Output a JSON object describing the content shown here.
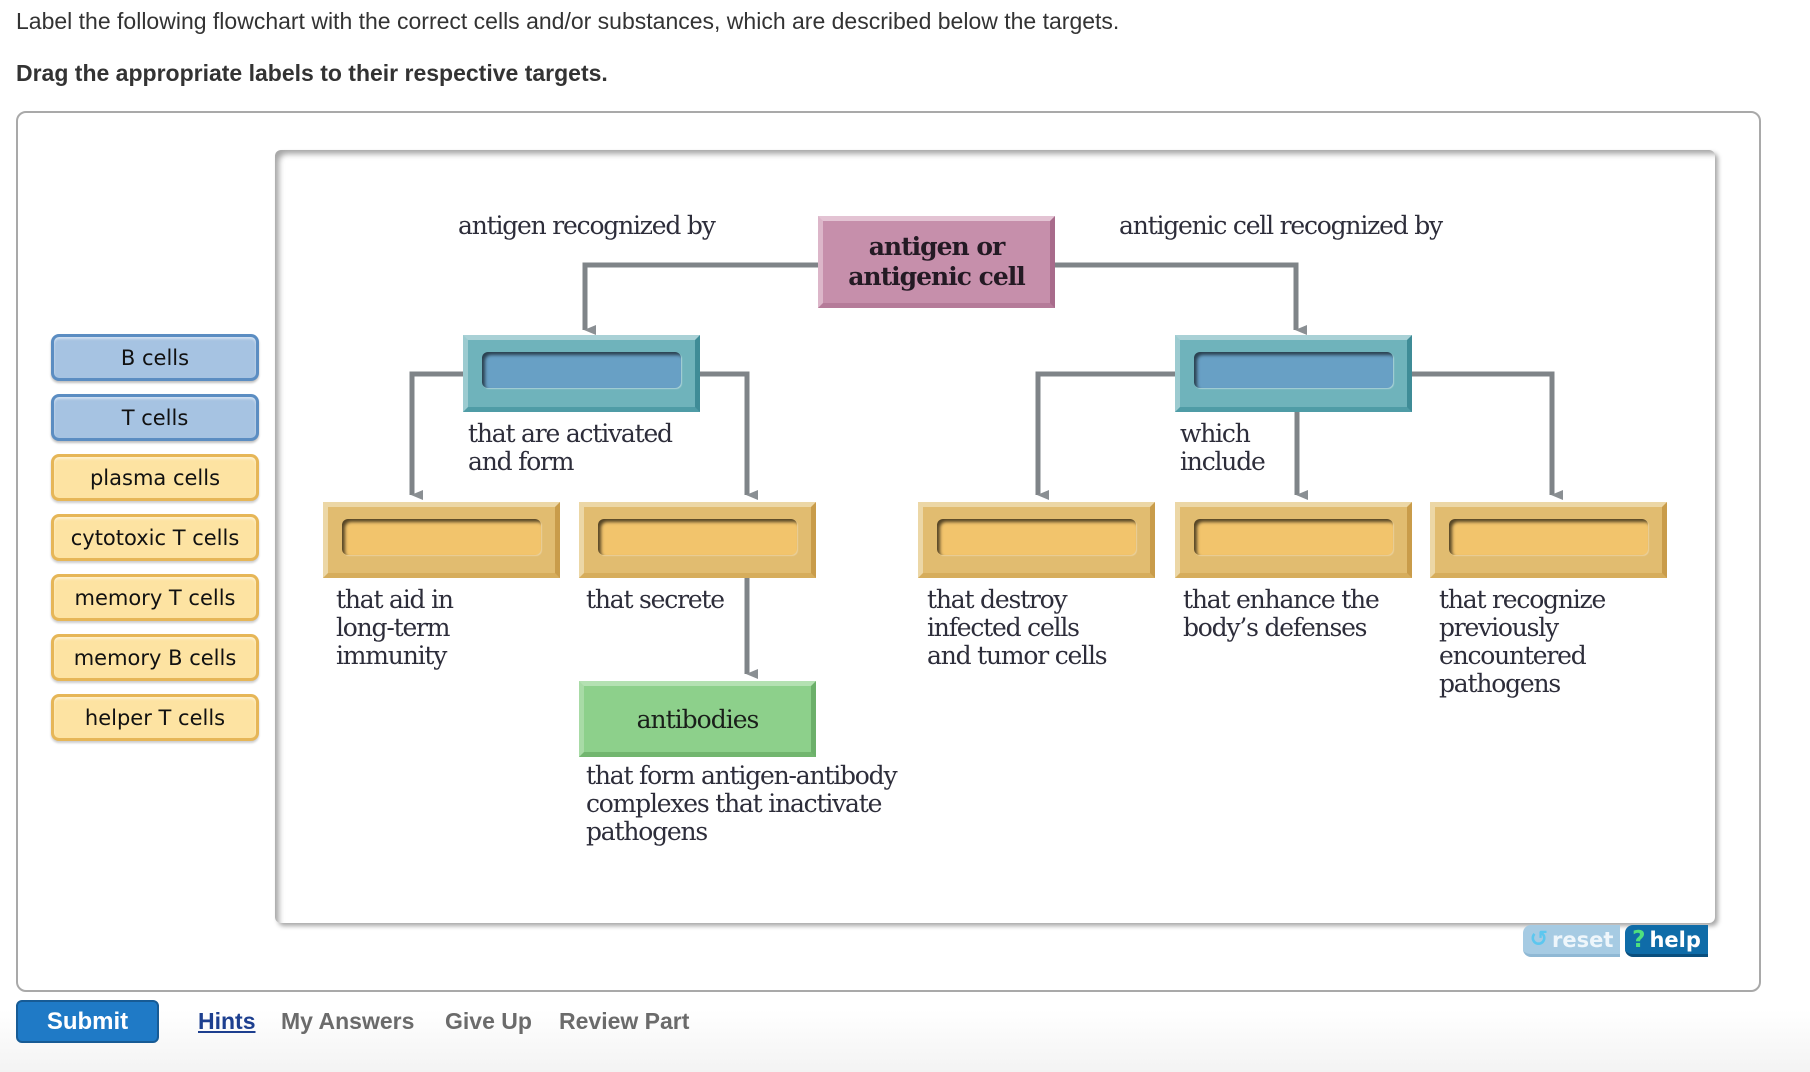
{
  "instructions": {
    "text": "Label the following flowchart with the correct cells and/or substances, which are described below the targets.",
    "bold": "Drag the appropriate labels to their respective targets."
  },
  "labels": [
    {
      "text": "B cells",
      "color": "blue"
    },
    {
      "text": "T cells",
      "color": "blue"
    },
    {
      "text": "plasma cells",
      "color": "yellow"
    },
    {
      "text": "cytotoxic T cells",
      "color": "yellow"
    },
    {
      "text": "memory T cells",
      "color": "yellow"
    },
    {
      "text": "memory B cells",
      "color": "yellow"
    },
    {
      "text": "helper T cells",
      "color": "yellow"
    }
  ],
  "diagram": {
    "root": {
      "line1": "antigen or",
      "line2": "antigenic cell"
    },
    "left_branch_caption": "antigen recognized by",
    "right_branch_caption": "antigenic cell recognized by",
    "left_target_caption": [
      "that are activated",
      "and form"
    ],
    "right_target_caption": [
      "which",
      "include"
    ],
    "leaf_captions": [
      [
        "that aid in",
        "long-term",
        "immunity"
      ],
      [
        "that secrete"
      ],
      [
        "that destroy",
        "infected cells",
        "and tumor cells"
      ],
      [
        "that enhance the",
        "body’s defenses"
      ],
      [
        "that recognize",
        "previously",
        "encountered",
        "pathogens"
      ]
    ],
    "product": {
      "label": "antibodies",
      "caption": [
        "that form antigen-antibody",
        "complexes that inactivate",
        "pathogens"
      ]
    },
    "colors": {
      "root": "#c68fab",
      "mid_target": "#6fb3bb",
      "leaf_target": "#e1bc70",
      "product": "#8dd08b",
      "connector": "#8a8f93"
    }
  },
  "controls": {
    "reset": {
      "icon": "reset-icon",
      "label": "reset"
    },
    "help": {
      "icon": "help-icon",
      "label": "help"
    }
  },
  "footer": {
    "submit": "Submit",
    "links": [
      "Hints",
      "My Answers",
      "Give Up",
      "Review Part"
    ]
  }
}
